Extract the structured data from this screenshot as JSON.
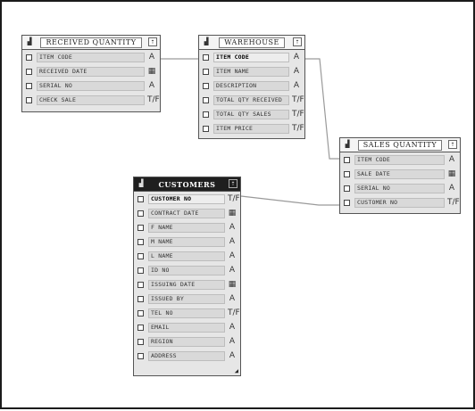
{
  "tables": {
    "received_quantity": {
      "title": "RECEIVED QUANTITY",
      "fields": [
        {
          "name": "ITEM CODE",
          "type": "A"
        },
        {
          "name": "RECEIVED DATE",
          "type": "▦"
        },
        {
          "name": "SERIAL NO",
          "type": "A"
        },
        {
          "name": "CHECK SALE",
          "type": "T/F"
        }
      ]
    },
    "warehouse": {
      "title": "WAREHOUSE",
      "fields": [
        {
          "name": "ITEM CODE",
          "type": "A",
          "key": true
        },
        {
          "name": "ITEM NAME",
          "type": "A"
        },
        {
          "name": "DESCRIPTION",
          "type": "A"
        },
        {
          "name": "TOTAL QTY RECEIVED",
          "type": "T/F"
        },
        {
          "name": "TOTAL QTY SALES",
          "type": "T/F"
        },
        {
          "name": "ITEM PRICE",
          "type": "T/F"
        }
      ]
    },
    "sales_quantity": {
      "title": "SALES QUANTITY",
      "fields": [
        {
          "name": "ITEM CODE",
          "type": "A"
        },
        {
          "name": "SALE DATE",
          "type": "▦"
        },
        {
          "name": "SERIAL NO",
          "type": "A"
        },
        {
          "name": "CUSTOMER NO",
          "type": "T/F"
        }
      ]
    },
    "customers": {
      "title": "CUSTOMERS",
      "fields": [
        {
          "name": "CUSTOMER NO",
          "type": "T/F",
          "key": true
        },
        {
          "name": "CONTRACT DATE",
          "type": "▦"
        },
        {
          "name": "F NAME",
          "type": "A"
        },
        {
          "name": "M NAME",
          "type": "A"
        },
        {
          "name": "L NAME",
          "type": "A"
        },
        {
          "name": "ID NO",
          "type": "A"
        },
        {
          "name": "ISSUING DATE",
          "type": "▦"
        },
        {
          "name": "ISSUED BY",
          "type": "A"
        },
        {
          "name": "TEL NO",
          "type": "T/F"
        },
        {
          "name": "EMAIL",
          "type": "A"
        },
        {
          "name": "REGION",
          "type": "A"
        },
        {
          "name": "ADDRESS",
          "type": "A"
        }
      ]
    }
  }
}
